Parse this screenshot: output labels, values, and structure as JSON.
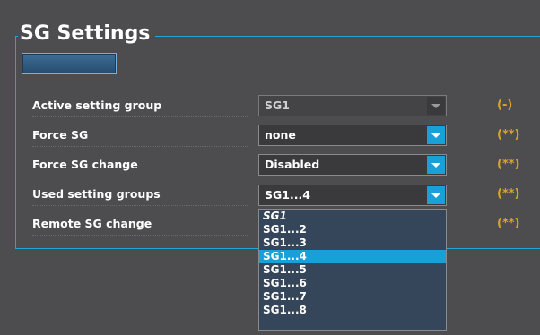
{
  "title": "SG Settings",
  "collapse_button": "-",
  "rows": [
    {
      "label": "Active setting group",
      "value": "SG1",
      "badge": "(-)"
    },
    {
      "label": "Force SG",
      "value": "none",
      "badge": "(**)"
    },
    {
      "label": "Force SG change",
      "value": "Disabled",
      "badge": "(**)"
    },
    {
      "label": "Used setting groups",
      "value": "SG1...4",
      "badge": "(**)"
    },
    {
      "label": "Remote SG change",
      "value": "",
      "badge": "(**)"
    }
  ],
  "dropdown": {
    "options": [
      "SG1",
      "SG1...2",
      "SG1...3",
      "SG1...4",
      "SG1...5",
      "SG1...6",
      "SG1...7",
      "SG1...8"
    ],
    "selected": "SG1...4"
  },
  "colors": {
    "accent": "#1aa0d8",
    "badge": "#d6a526",
    "background": "#4d4d4f"
  }
}
